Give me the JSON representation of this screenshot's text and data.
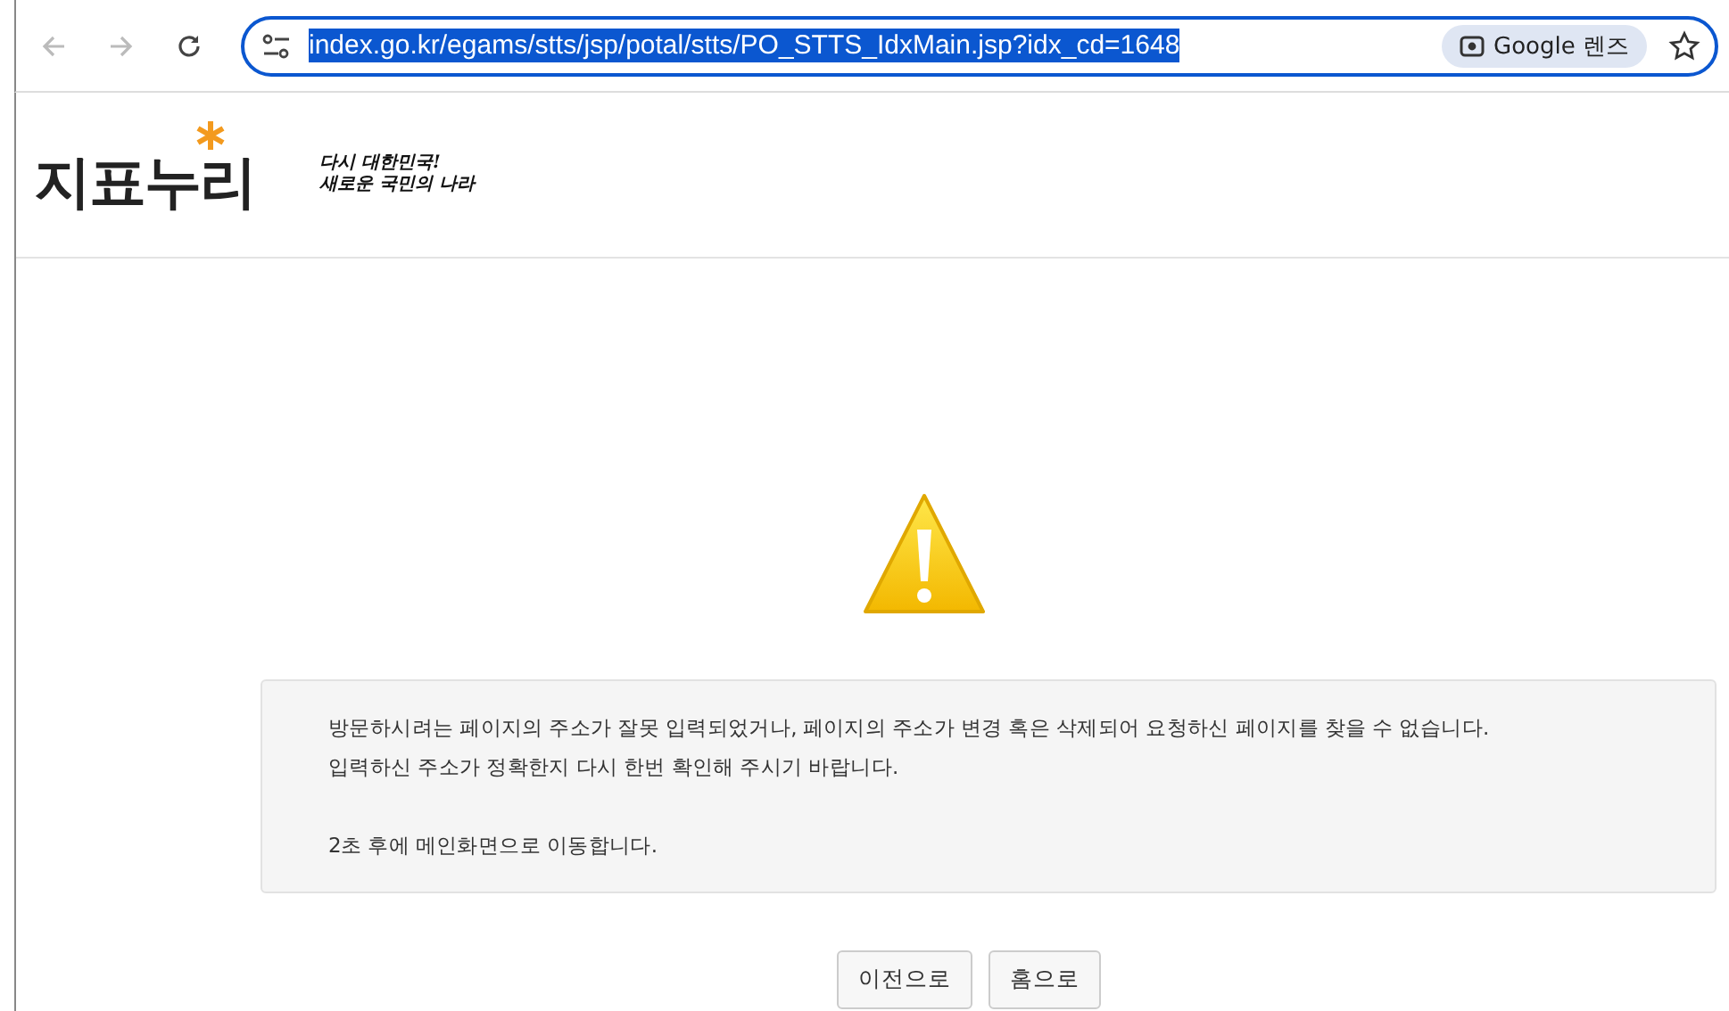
{
  "browser": {
    "url": "index.go.kr/egams/stts/jsp/potal/stts/PO_STTS_IdxMain.jsp?idx_cd=1648",
    "url_selected": true,
    "lens_label": "Google 렌즈"
  },
  "header": {
    "logo": "지표누리",
    "slogan": [
      "다시 대한민국!",
      "새로운 국민의 나라"
    ]
  },
  "message": {
    "lines": [
      "방문하시려는 페이지의 주소가 잘못 입력되었거나,  페이지의 주소가 변경 혹은 삭제되어 요청하신 페이지를 찾을 수 없습니다.",
      "입력하신 주소가 정확한지 다시 한번 확인해 주시기 바랍니다."
    ],
    "redirect": "2초 후에 메인화면으로 이동합니다."
  },
  "buttons": [
    "이전으로",
    "홈으로"
  ]
}
